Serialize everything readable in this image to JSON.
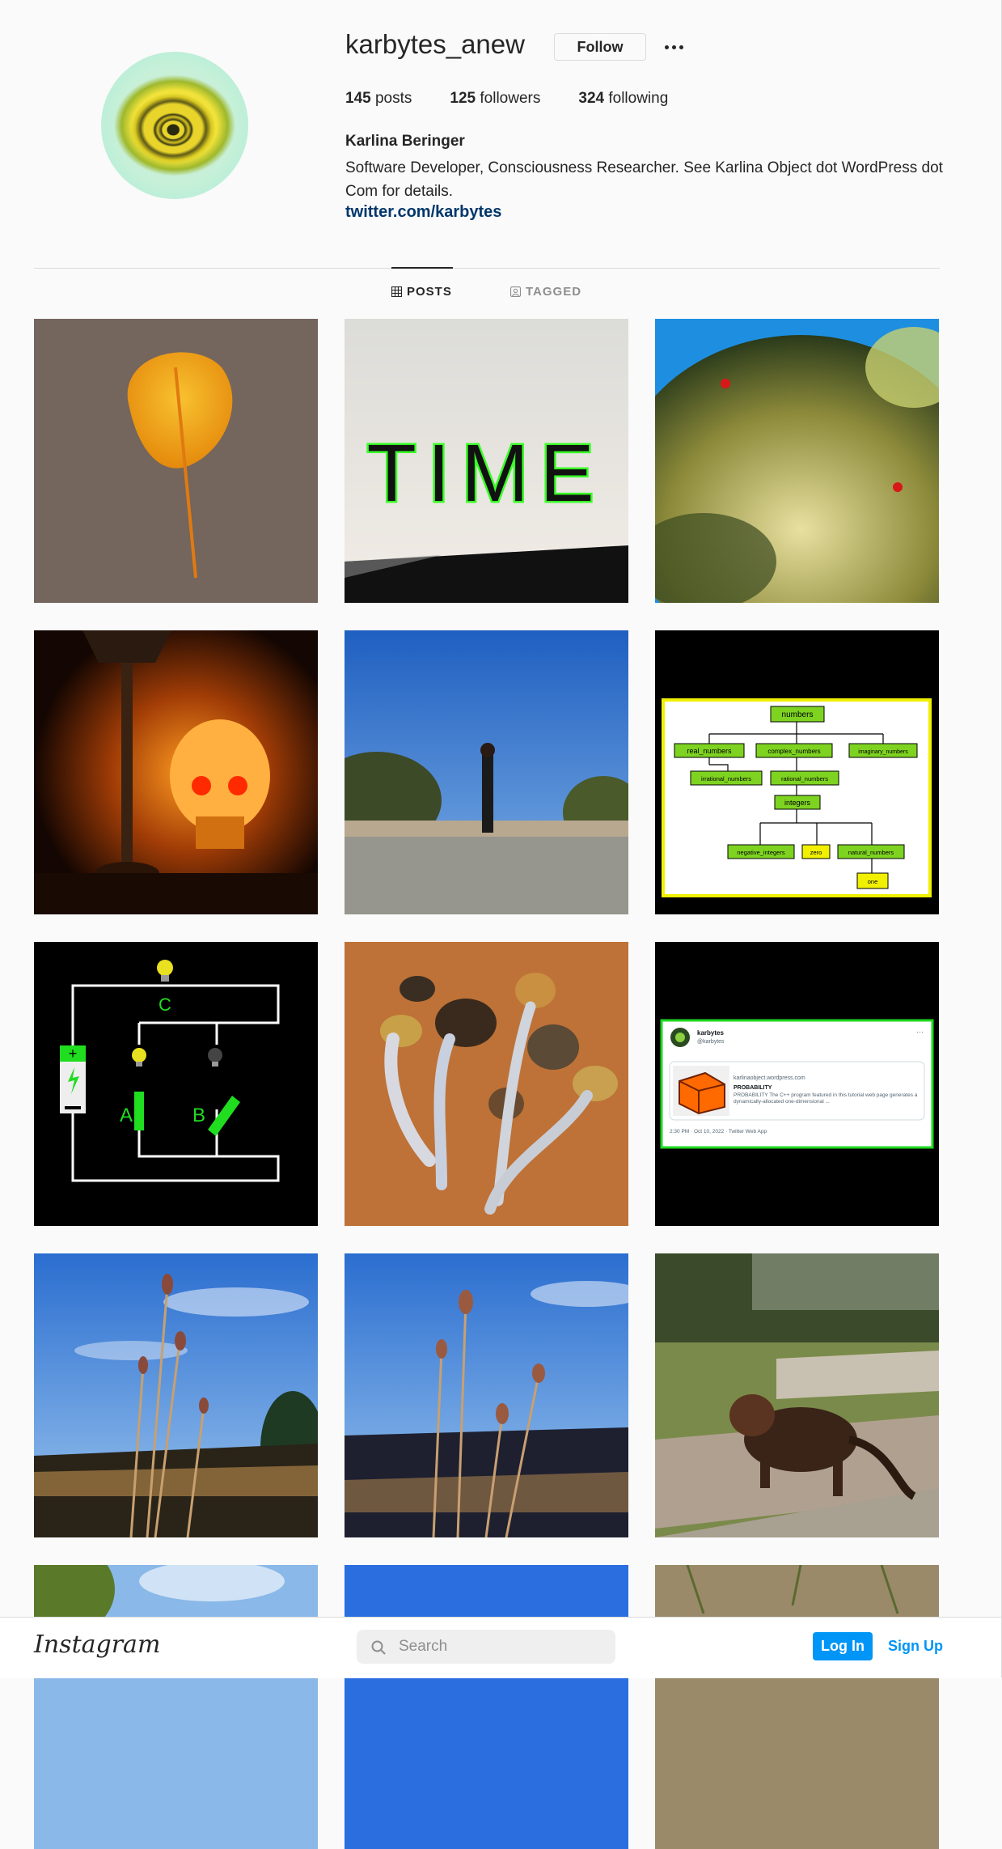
{
  "profile": {
    "username": "karbytes_anew",
    "follow_label": "Follow",
    "more_icon": "more-icon",
    "stats": {
      "posts_count": "145",
      "posts_label": "posts",
      "followers_count": "125",
      "followers_label": "followers",
      "following_count": "324",
      "following_label": "following"
    },
    "full_name": "Karlina Beringer",
    "bio": "Software Developer, Consciousness Researcher. See Karlina Object dot WordPress dot Com for details.",
    "link": "twitter.com/karbytes"
  },
  "tabs": [
    {
      "label": "POSTS",
      "icon": "grid-icon",
      "active": true
    },
    {
      "label": "TAGGED",
      "icon": "tag-icon",
      "active": false
    }
  ],
  "posts": {
    "time_text": "TIME",
    "diagram": {
      "root": "numbers",
      "row2": [
        "real_numbers",
        "complex_numbers",
        "imaginary_numbers"
      ],
      "row3": [
        "irrational_numbers",
        "rational_numbers"
      ],
      "row4": "integers",
      "row5": [
        "negative_integers",
        "zero",
        "natural_numbers"
      ],
      "row6": "one"
    },
    "circuit": {
      "label_a": "A",
      "label_b": "B",
      "label_c": "C"
    },
    "tweet": {
      "name": "karbytes",
      "handle": "@karbytes",
      "domain": "karlinaobject.wordpress.com",
      "title": "PROBABILITY",
      "body": "PROBABILITY The C++ program featured in this tutorial web page generates a dynamically-allocated one-dimensional ...",
      "footer": "2:30 PM · Oct 10, 2022 · Twitter Web App"
    }
  },
  "bottom_bar": {
    "logo": "Instagram",
    "search_placeholder": "Search",
    "login_label": "Log In",
    "signup_label": "Sign Up"
  },
  "colors": {
    "primary_blue": "#0095f6",
    "link_blue": "#00376b",
    "text": "#262626",
    "muted": "#8e8e8e",
    "border": "#dbdbdb"
  }
}
